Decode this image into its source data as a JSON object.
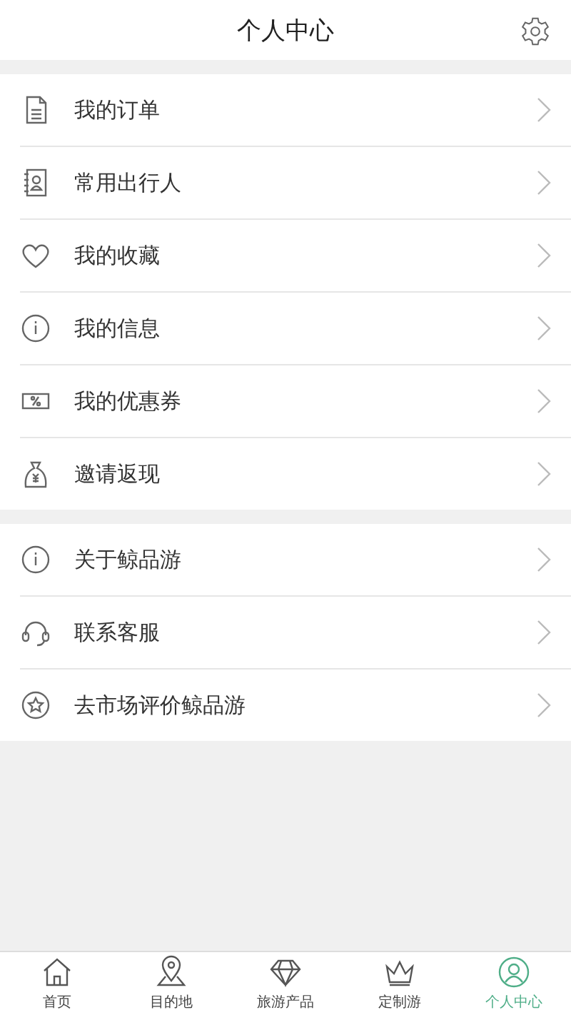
{
  "header": {
    "title": "个人中心"
  },
  "menu_groups": [
    {
      "items": [
        {
          "label": "我的订单",
          "kind": "document"
        },
        {
          "label": "常用出行人",
          "kind": "contacts"
        },
        {
          "label": "我的收藏",
          "kind": "heart"
        },
        {
          "label": "我的信息",
          "kind": "info"
        },
        {
          "label": "我的优惠券",
          "kind": "coupon"
        },
        {
          "label": "邀请返现",
          "kind": "moneybag"
        }
      ]
    },
    {
      "items": [
        {
          "label": "关于鲸品游",
          "kind": "info"
        },
        {
          "label": "联系客服",
          "kind": "headset"
        },
        {
          "label": "去市场评价鲸品游",
          "kind": "star"
        }
      ]
    }
  ],
  "tab_bar": [
    {
      "label": "首页",
      "kind": "home",
      "selected": false
    },
    {
      "label": "目的地",
      "kind": "pin",
      "selected": false
    },
    {
      "label": "旅游产品",
      "kind": "diamond",
      "selected": false
    },
    {
      "label": "定制游",
      "kind": "crown",
      "selected": false
    },
    {
      "label": "个人中心",
      "kind": "person",
      "selected": true
    }
  ]
}
